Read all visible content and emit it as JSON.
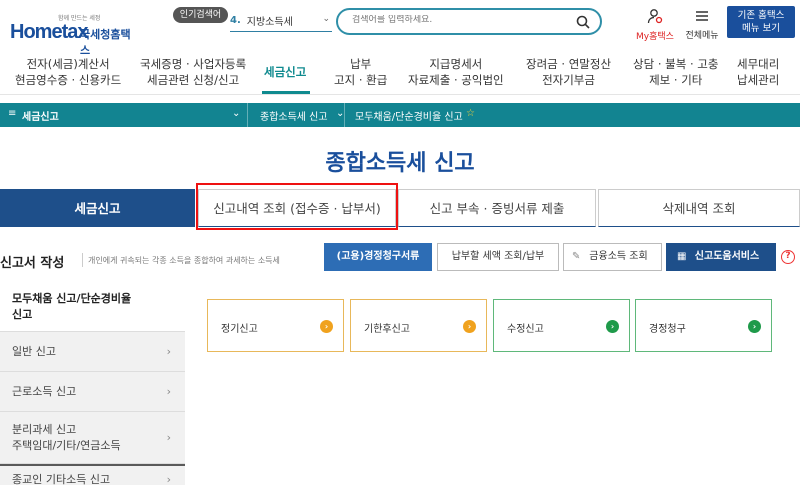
{
  "header": {
    "logo_tagline": "함께 만드는 세정",
    "logo_text": "Hometax",
    "logo_sub": "국세청홈택스",
    "popular_badge": "인기검색어",
    "popular_num": "4.",
    "popular_term": "지방소득세",
    "search_placeholder": "검색어를 입력하세요.",
    "my_hometax": "My홈택스",
    "all_menu": "전체메뉴",
    "old_home_line1": "기존 홈택스",
    "old_home_line2": "메뉴 보기"
  },
  "gnb": [
    {
      "line1": "전자(세금)계산서",
      "line2": "현금영수증 · 신용카드"
    },
    {
      "line1": "국세증명 · 사업자등록",
      "line2": "세금관련 신청/신고"
    },
    {
      "line1": "세금신고",
      "line2": ""
    },
    {
      "line1": "납부",
      "line2": "고지 · 환급"
    },
    {
      "line1": "지급명세서",
      "line2": "자료제출 · 공익법인"
    },
    {
      "line1": "장려금 · 연말정산",
      "line2": "전자기부금"
    },
    {
      "line1": "상담 · 불복 · 고충",
      "line2": "제보 · 기타"
    },
    {
      "line1": "세무대리",
      "line2": "납세관리"
    }
  ],
  "breadcrumb": {
    "section": "세금신고",
    "sub": "종합소득세 신고",
    "current": "모두채움/단순경비율 신고"
  },
  "page_title": "종합소득세 신고",
  "tabs": [
    "세금신고",
    "신고내역 조회 (접수증 · 납부서)",
    "신고 부속 · 증빙서류 제출",
    "삭제내역 조회"
  ],
  "section": {
    "title": "신고서 작성",
    "desc": "개인에게 귀속되는 각종 소득을 종합하여 과세하는 소득세",
    "buttons": [
      "(고용)경정청구서류",
      "납부할 세액 조회/납부",
      "금융소득 조회",
      "신고도움서비스"
    ]
  },
  "side_menu": [
    {
      "line1": "모두채움 신고/단순경비율",
      "line2": "신고"
    },
    {
      "line1": "일반 신고",
      "line2": ""
    },
    {
      "line1": "근로소득 신고",
      "line2": ""
    },
    {
      "line1": "분리과세 신고",
      "line2": "주택임대/기타/연금소득"
    },
    {
      "line1": "종교인 기타소득 신고",
      "line2": ""
    }
  ],
  "cards": [
    "정기신고",
    "기한후신고",
    "수정신고",
    "경정청구"
  ],
  "colors": {
    "brand": "#1a4f9c",
    "teal": "#128491",
    "highlight": "#e11"
  }
}
